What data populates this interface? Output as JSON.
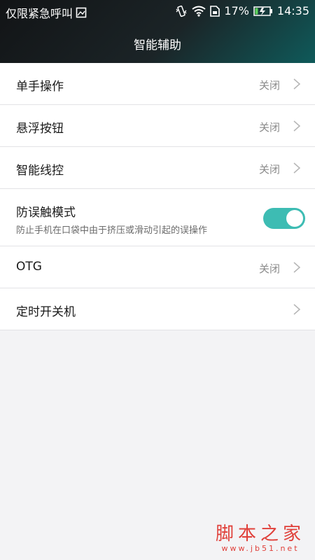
{
  "status_bar": {
    "emergency_text": "仅限紧急呼叫",
    "battery_percent": "17%",
    "time": "14:35"
  },
  "page": {
    "title": "智能辅助"
  },
  "settings": [
    {
      "label": "单手操作",
      "value": "关闭"
    },
    {
      "label": "悬浮按钮",
      "value": "关闭"
    },
    {
      "label": "智能线控",
      "value": "关闭"
    },
    {
      "label": "防误触模式",
      "description": "防止手机在口袋中由于挤压或滑动引起的误操作",
      "toggle_on": true
    },
    {
      "label": "OTG",
      "value": "关闭"
    },
    {
      "label": "定时开关机",
      "value": ""
    }
  ],
  "watermark": {
    "main": "脚本之家",
    "sub": "www.jb51.net"
  },
  "colors": {
    "toggle_on": "#3dbcb3",
    "watermark": "#e0403a"
  }
}
